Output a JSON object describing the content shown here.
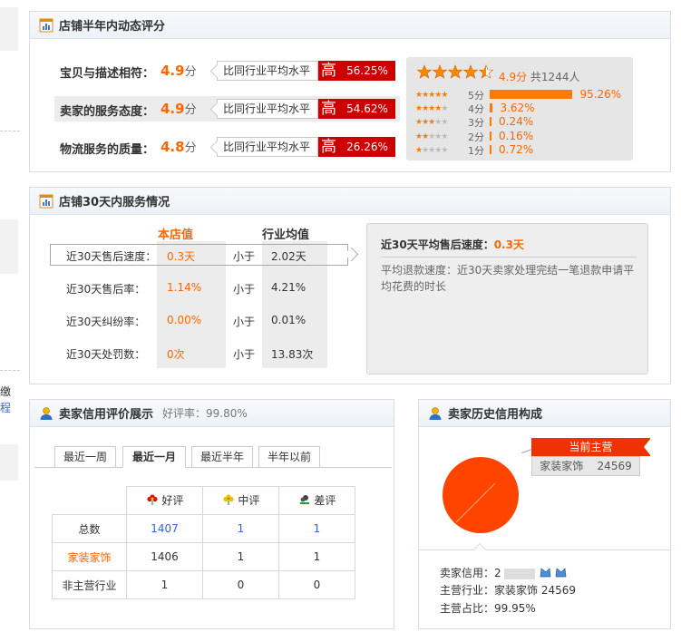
{
  "left_fragment": {
    "text1": "缴",
    "text2": "程"
  },
  "dynamic": {
    "title": "店铺半年内动态评分",
    "rows": [
      {
        "label": "宝贝与描述相符：",
        "score": "4.9",
        "unit": "分",
        "cmp": "比同行业平均水平",
        "level": "高",
        "pct": "56.25%"
      },
      {
        "label": "卖家的服务态度：",
        "score": "4.9",
        "unit": "分",
        "cmp": "比同行业平均水平",
        "level": "高",
        "pct": "54.62%"
      },
      {
        "label": "物流服务的质量：",
        "score": "4.8",
        "unit": "分",
        "cmp": "比同行业平均水平",
        "level": "高",
        "pct": "26.26%"
      }
    ],
    "rating": {
      "score": "4.9分",
      "count": "共1244人",
      "stars": 4.5,
      "dist": [
        {
          "label": "5分",
          "pct": "95.26%",
          "value": 95.26
        },
        {
          "label": "4分",
          "pct": "3.62%",
          "value": 3.62
        },
        {
          "label": "3分",
          "pct": "0.24%",
          "value": 0.24
        },
        {
          "label": "2分",
          "pct": "0.16%",
          "value": 0.16
        },
        {
          "label": "1分",
          "pct": "0.72%",
          "value": 0.72
        }
      ]
    }
  },
  "service": {
    "title": "店铺30天内服务情况",
    "col_store": "本店值",
    "col_industry": "行业均值",
    "rows": [
      {
        "label": "近30天售后速度：",
        "value": "0.3天",
        "cmp": "小于",
        "avg": "2.02天"
      },
      {
        "label": "近30天售后率：",
        "value": "1.14%",
        "cmp": "小于",
        "avg": "4.21%"
      },
      {
        "label": "近30天纠纷率：",
        "value": "0.00%",
        "cmp": "小于",
        "avg": "0.01%"
      },
      {
        "label": "近30天处罚数：",
        "value": "0次",
        "cmp": "小于",
        "avg": "13.83次"
      }
    ],
    "detail_title": "近30天平均售后速度：",
    "detail_value": "0.3天",
    "detail_text": "平均退款速度：近30天卖家处理完结一笔退款申请平均花费的时长"
  },
  "credit": {
    "title": "卖家信用评价展示",
    "rate_label": "好评率：",
    "rate_value": "99.80%",
    "tabs": [
      "最近一周",
      "最近一月",
      "最近半年",
      "半年以前"
    ],
    "active_tab": 1,
    "headers": [
      "好评",
      "中评",
      "差评"
    ],
    "rows": [
      {
        "label": "总数",
        "good": "1407",
        "mid": "1",
        "bad": "1"
      },
      {
        "label": "家装家饰",
        "good": "1406",
        "mid": "1",
        "bad": "1"
      },
      {
        "label": "非主营行业",
        "good": "1",
        "mid": "0",
        "bad": "0"
      }
    ]
  },
  "history": {
    "title": "卖家历史信用构成",
    "current_label": "当前主营",
    "category": "家装家饰",
    "category_value": "24569",
    "pie_color": "#ff4400",
    "seller_credit_label": "卖家信用：",
    "seller_credit_value": "2",
    "main_industry_label": "主营行业：",
    "main_industry_value": "家装家饰 24569",
    "main_share_label": "主营占比：",
    "main_share_value": "99.95%"
  }
}
